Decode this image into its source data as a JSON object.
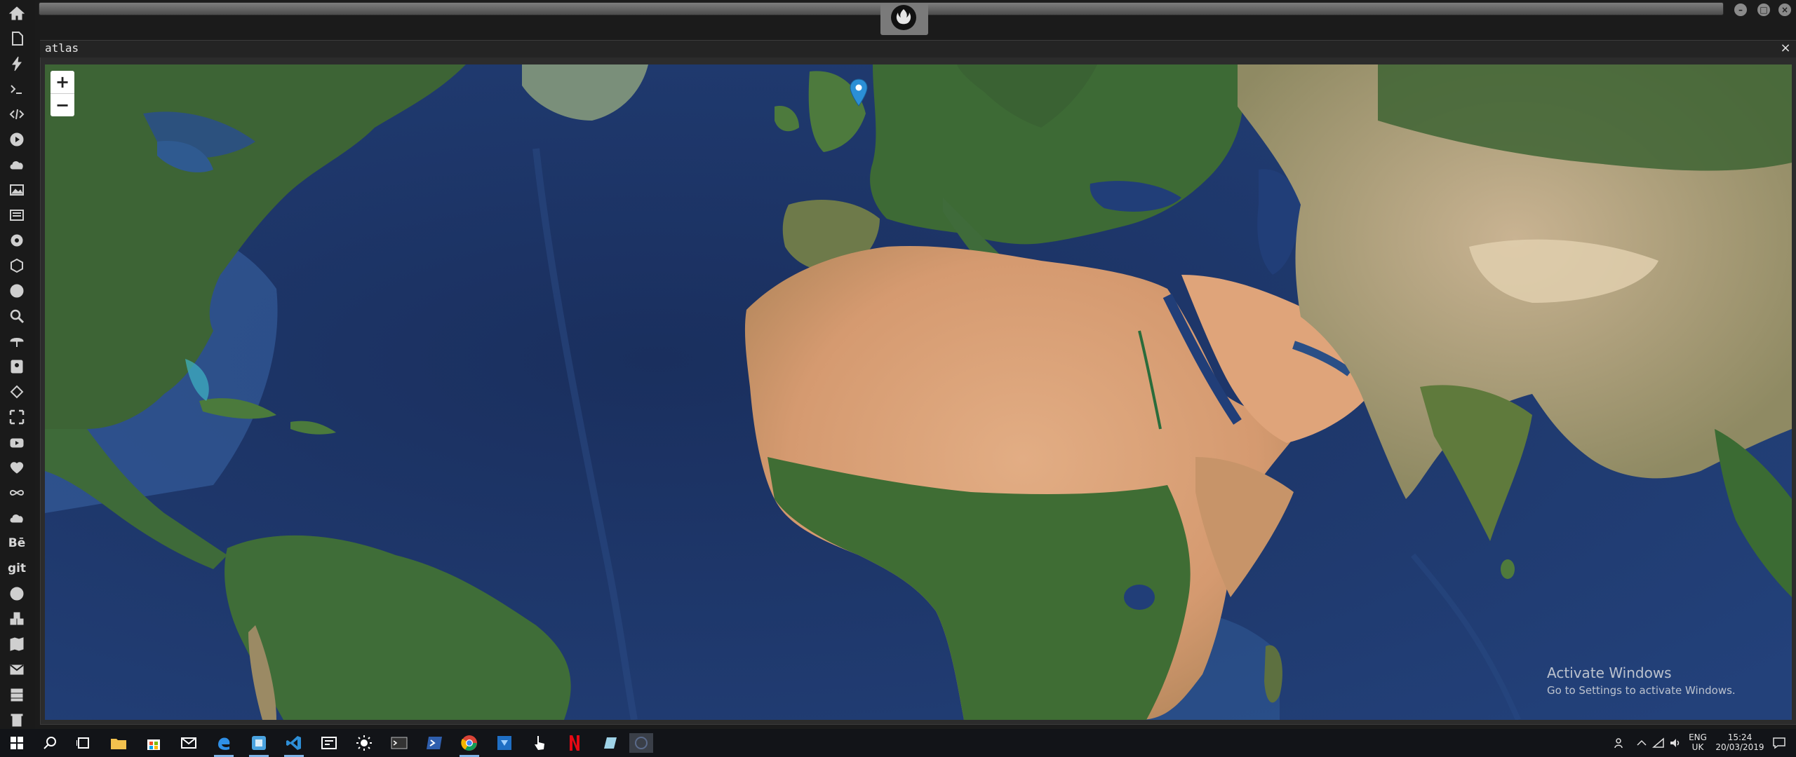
{
  "window": {
    "title": "atlas",
    "close_glyph": "×"
  },
  "map": {
    "style": "satellite imagery",
    "zoom_in_label": "+",
    "zoom_out_label": "−",
    "marker_icon": "map-pin-icon",
    "marker_color": "#2b8fd6"
  },
  "watermark": {
    "line1": "Activate Windows",
    "line2": "Go to Settings to activate Windows."
  },
  "sidebar": {
    "items": [
      {
        "icon": "home-icon"
      },
      {
        "icon": "file-icon"
      },
      {
        "icon": "bolt-icon"
      },
      {
        "icon": "terminal-icon"
      },
      {
        "icon": "code-icon"
      },
      {
        "icon": "play-circle-icon"
      },
      {
        "icon": "cloud-icon"
      },
      {
        "icon": "image-icon"
      },
      {
        "icon": "newspaper-icon"
      },
      {
        "icon": "gear-icon"
      },
      {
        "icon": "hexagon-icon"
      },
      {
        "icon": "globe-icon"
      },
      {
        "icon": "search-icon"
      },
      {
        "icon": "umbrella-icon"
      },
      {
        "icon": "contact-icon"
      },
      {
        "icon": "diamond-icon"
      },
      {
        "icon": "expand-icon"
      },
      {
        "icon": "youtube-icon"
      },
      {
        "icon": "heart-icon"
      },
      {
        "icon": "infinity-icon"
      },
      {
        "icon": "cloud-icon"
      },
      {
        "icon": "behance-icon",
        "text": "Bē"
      },
      {
        "icon": "git-icon",
        "text": "git"
      },
      {
        "icon": "github-icon"
      },
      {
        "icon": "cubes-icon"
      },
      {
        "icon": "map-icon"
      },
      {
        "icon": "envelope-icon"
      },
      {
        "icon": "server-icon"
      },
      {
        "icon": "trash-icon"
      }
    ]
  },
  "topbar": {
    "logo_icon": "rebel-alliance-icon",
    "window_buttons": [
      "minimize-button",
      "maximize-button",
      "close-button"
    ]
  },
  "taskbar": {
    "apps": [
      "start-icon",
      "search-icon",
      "task-view-icon",
      "file-explorer-icon",
      "store-icon",
      "mail-icon",
      "edge-icon",
      "app-icon",
      "vscode-icon",
      "news-icon",
      "weather-icon",
      "terminal-icon",
      "powershell-icon",
      "chrome-icon",
      "remote-icon",
      "pointer-icon",
      "netflix-icon",
      "notes-icon",
      "app-icon"
    ],
    "language": "ENG",
    "region": "UK",
    "time": "15:24",
    "date": "20/03/2019"
  },
  "colors": {
    "ocean": "#1d3a6d",
    "desert": "#d9a27a",
    "land_green": "#3e6a39",
    "accent": "#2b8fd6"
  }
}
